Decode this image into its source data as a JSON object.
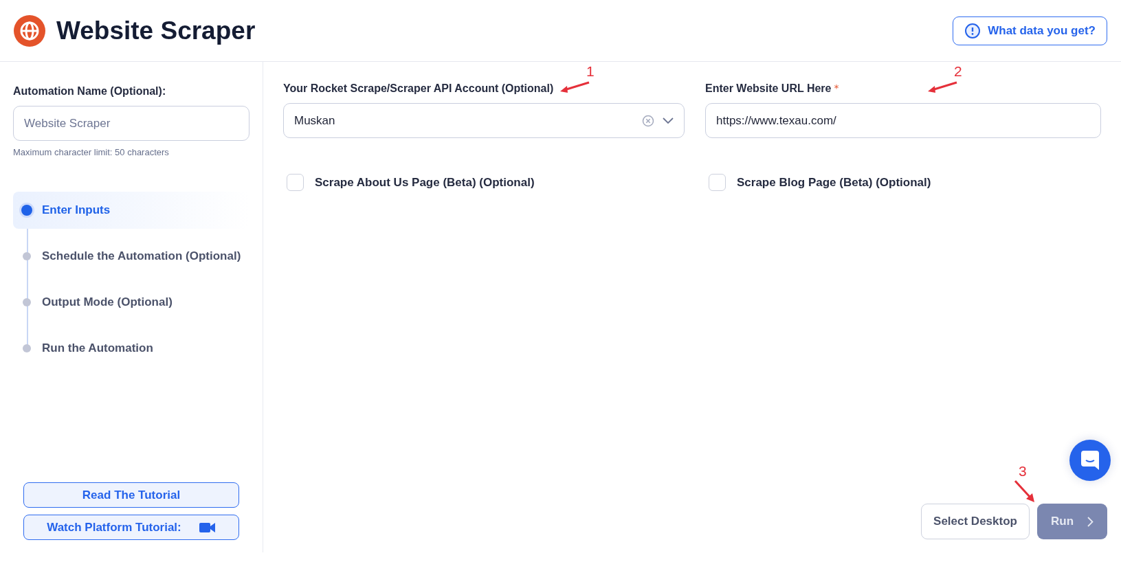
{
  "header": {
    "title": "Website Scraper",
    "help_button": "What data you get?"
  },
  "sidebar": {
    "name_label": "Automation Name (Optional):",
    "name_field": {
      "placeholder": "Website Scraper"
    },
    "hint": "Maximum character limit: 50 characters",
    "steps": [
      {
        "label": "Enter Inputs",
        "selected": true
      },
      {
        "label": "Schedule the Automation (Optional)",
        "selected": false
      },
      {
        "label": "Output Mode (Optional)",
        "selected": false
      },
      {
        "label": "Run the Automation",
        "selected": false
      }
    ],
    "buttons": [
      {
        "label": "Read The Tutorial",
        "kind": "text"
      },
      {
        "label": "Watch Platform Tutorial:",
        "kind": "video"
      }
    ]
  },
  "form": {
    "account": {
      "label": "Your Rocket Scrape/Scraper API Account (Optional)",
      "value": "Muskan"
    },
    "url": {
      "label": "Enter Website URL Here",
      "required_mark": "*",
      "value": "https://www.texau.com/"
    },
    "checkboxes": [
      {
        "label": "Scrape About Us Page (Beta) (Optional)",
        "checked": false
      },
      {
        "label": "Scrape Blog Page (Beta) (Optional)",
        "checked": false
      }
    ]
  },
  "footer": {
    "select_desktop": "Select Desktop",
    "run": {
      "label": "Run",
      "disabled": true
    }
  },
  "annotations": [
    "1",
    "2",
    "3"
  ]
}
